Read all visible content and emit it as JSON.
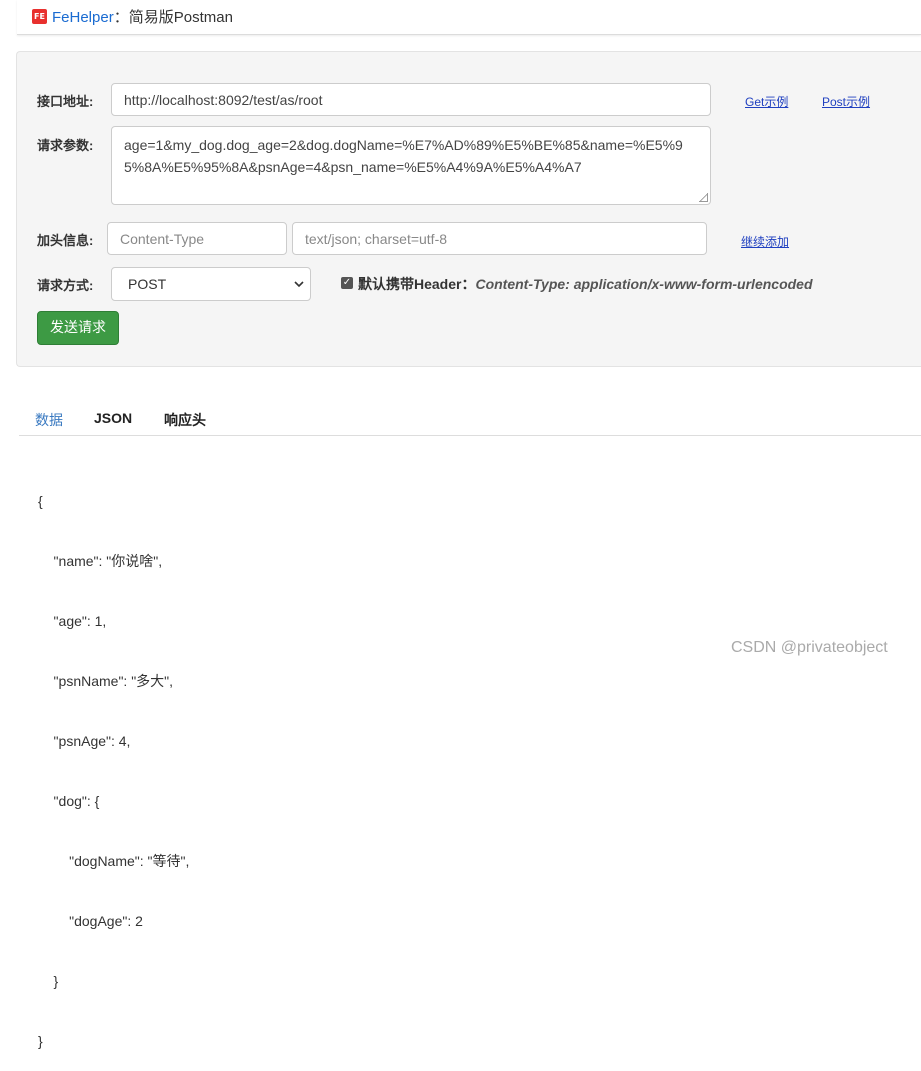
{
  "header": {
    "logo_text": "FE",
    "brand": "FeHelper",
    "separator": "：",
    "subtitle": "简易版Postman"
  },
  "form": {
    "url_label": "接口地址:",
    "url_value": "http://localhost:8092/test/as/root",
    "get_example": "Get示例",
    "post_example": "Post示例",
    "params_label": "请求参数:",
    "params_value": "age=1&my_dog.dog_age=2&dog.dogName=%E7%AD%89%E5%BE%85&name=%E5%95%8A%E5%95%8A&psnAge=4&psn_name=%E5%A4%9A%E5%A4%A7",
    "header_label": "加头信息:",
    "header_key_placeholder": "Content-Type",
    "header_value_placeholder": "text/json; charset=utf-8",
    "add_more": "继续添加",
    "method_label": "请求方式:",
    "method_value": "POST",
    "default_header_label": "默认携带Header：",
    "default_header_value": "Content-Type: application/x-www-form-urlencoded",
    "default_header_checked": true,
    "send_button": "发送请求"
  },
  "tabs": [
    "数据",
    "JSON",
    "响应头"
  ],
  "response_lines": [
    "{",
    "    \"name\": \"你说啥\",",
    "    \"age\": 1,",
    "    \"psnName\": \"多大\",",
    "    \"psnAge\": 4,",
    "    \"dog\": {",
    "        \"dogName\": \"等待\",",
    "        \"dogAge\": 2",
    "    }",
    "}"
  ],
  "watermark": "CSDN @privateobject",
  "colors": {
    "primary_button": "#3d9a44",
    "active_tab": "#3878c0",
    "brand": "#1a6bd1",
    "link": "#2040c0"
  }
}
